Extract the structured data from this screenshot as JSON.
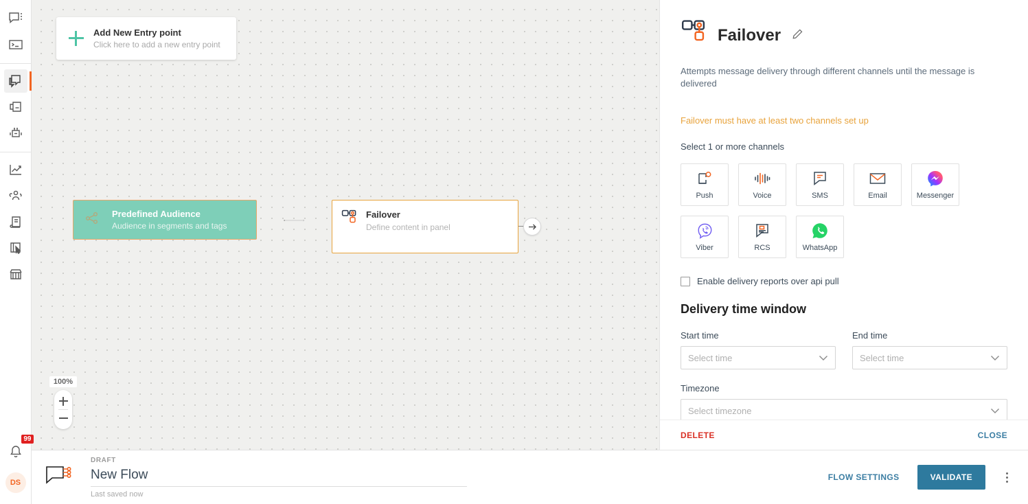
{
  "sidebar": {
    "items": [
      {
        "name": "conversations",
        "icon": "chat-bubble-icon"
      },
      {
        "name": "console",
        "icon": "terminal-icon"
      },
      {
        "name": "flows",
        "icon": "flows-icon",
        "active": true
      },
      {
        "name": "broadcast",
        "icon": "broadcast-icon"
      },
      {
        "name": "bots",
        "icon": "robot-icon"
      },
      {
        "name": "analytics",
        "icon": "analytics-chart-icon"
      },
      {
        "name": "audience",
        "icon": "people-group-icon"
      },
      {
        "name": "content",
        "icon": "book-icon"
      },
      {
        "name": "templates",
        "icon": "template-cursor-icon"
      },
      {
        "name": "marketplace",
        "icon": "storefront-icon"
      }
    ],
    "notifications": {
      "icon": "bell-icon",
      "badge": "99"
    },
    "avatar": {
      "initials": "DS"
    }
  },
  "canvas": {
    "entry_card": {
      "title": "Add New Entry point",
      "subtitle": "Click here to add a new entry point",
      "icon": "plus-icon"
    },
    "nodes": [
      {
        "id": "audience",
        "title": "Predefined Audience",
        "subtitle": "Audience in segments and tags",
        "icon": "audience-network-icon",
        "color": "#7ecfb8"
      },
      {
        "id": "failover",
        "title": "Failover",
        "subtitle": "Define content in panel",
        "icon": "failover-icon",
        "selected": true,
        "border_color": "#e8a33c"
      }
    ],
    "zoom": {
      "level": "100%",
      "zoom_in": "+",
      "zoom_out": "-"
    }
  },
  "panel": {
    "icon": "failover-icon",
    "title": "Failover",
    "edit_icon": "pencil-icon",
    "description": "Attempts message delivery through different channels until the message is delivered",
    "warning": "Failover must have at least two channels set up",
    "channels_label": "Select 1 or more channels",
    "channels": [
      {
        "name": "Push",
        "icon": "push-notification-icon"
      },
      {
        "name": "Voice",
        "icon": "voice-waveform-icon"
      },
      {
        "name": "SMS",
        "icon": "sms-bubble-icon"
      },
      {
        "name": "Email",
        "icon": "envelope-icon"
      },
      {
        "name": "Messenger",
        "icon": "messenger-icon"
      },
      {
        "name": "Viber",
        "icon": "viber-icon"
      },
      {
        "name": "RCS",
        "icon": "rcs-bubble-icon"
      },
      {
        "name": "WhatsApp",
        "icon": "whatsapp-icon"
      }
    ],
    "api_pull": {
      "label": "Enable delivery reports over api pull",
      "checked": false
    },
    "delivery_window": {
      "title": "Delivery time window",
      "start_label": "Start time",
      "start_value": "Select time",
      "end_label": "End time",
      "end_value": "Select time",
      "timezone_label": "Timezone",
      "timezone_value": "Select timezone"
    },
    "delete_label": "DELETE",
    "close_label": "CLOSE"
  },
  "bottombar": {
    "flow_icon": "flow-node-icon",
    "status": "DRAFT",
    "flow_name": "New Flow",
    "saved_text": "Last saved now",
    "flow_settings_label": "FLOW SETTINGS",
    "validate_label": "VALIDATE",
    "more_icon": "kebab-menu-icon"
  },
  "colors": {
    "accent_orange": "#f26522",
    "warning": "#e8a33c",
    "primary_blue": "#2e7a9e",
    "link_blue": "#3c7ea3",
    "danger_red": "#d93025",
    "node_teal": "#7ecfb8",
    "badge_red": "#e02020"
  }
}
